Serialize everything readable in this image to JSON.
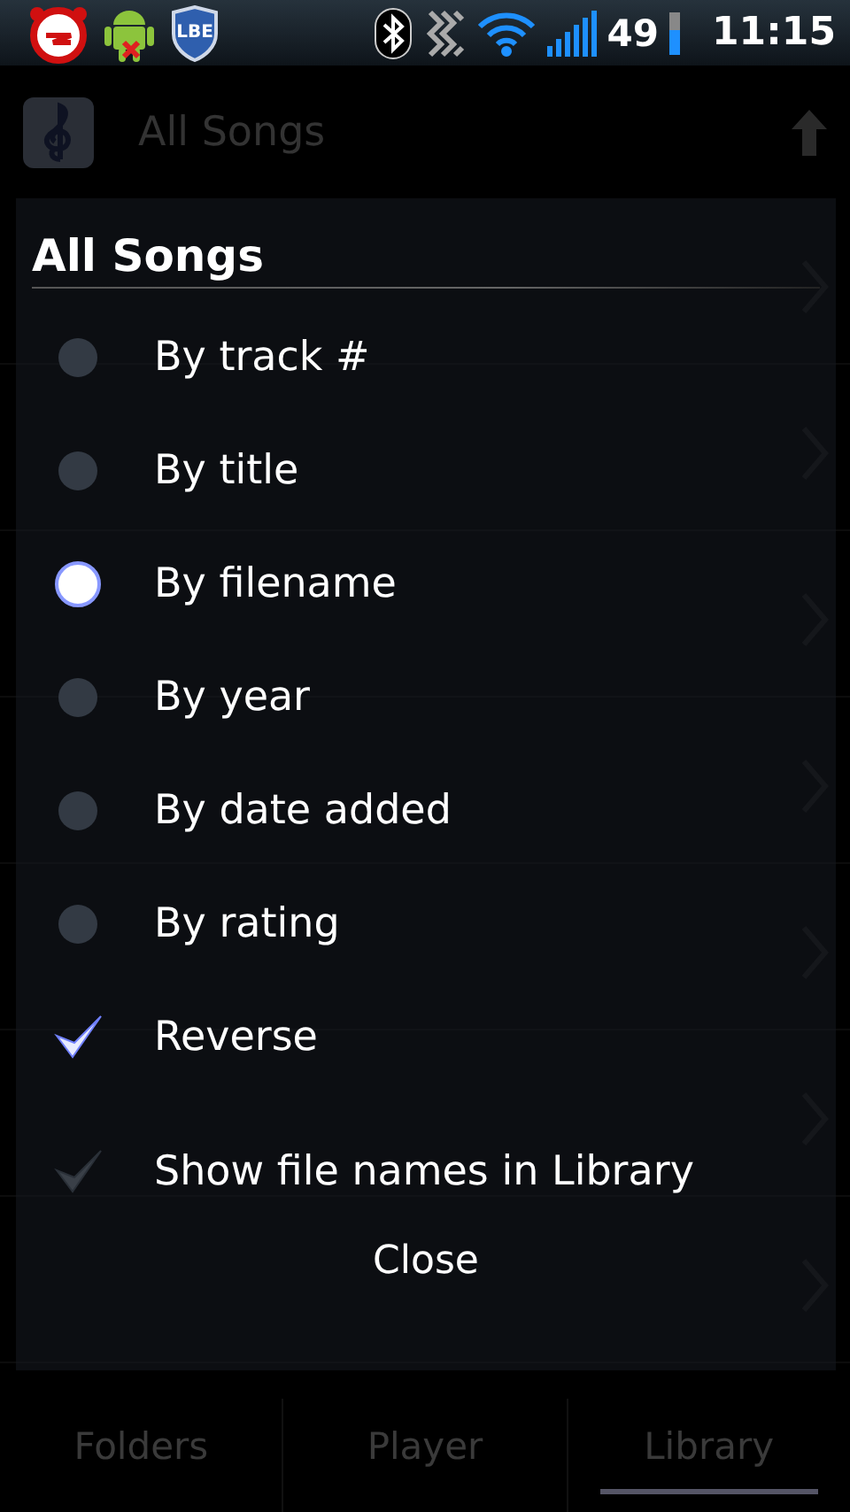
{
  "status_bar": {
    "shield_text": "LBE",
    "battery": "49",
    "time": "11:15"
  },
  "header": {
    "title": "All Songs"
  },
  "dialog": {
    "title": "All Songs",
    "options": [
      {
        "kind": "radio",
        "label": "By track #",
        "selected": false
      },
      {
        "kind": "radio",
        "label": "By title",
        "selected": false
      },
      {
        "kind": "radio",
        "label": "By filename",
        "selected": true
      },
      {
        "kind": "radio",
        "label": "By year",
        "selected": false
      },
      {
        "kind": "radio",
        "label": "By date added",
        "selected": false
      },
      {
        "kind": "radio",
        "label": "By rating",
        "selected": false
      },
      {
        "kind": "check",
        "label": "Reverse",
        "checked": true
      },
      {
        "kind": "check",
        "label": "Show file names in Library",
        "checked": false
      }
    ],
    "button": "Close"
  },
  "tabs": [
    {
      "label": "Folders",
      "selected": false
    },
    {
      "label": "Player",
      "selected": false
    },
    {
      "label": "Library",
      "selected": true
    }
  ]
}
